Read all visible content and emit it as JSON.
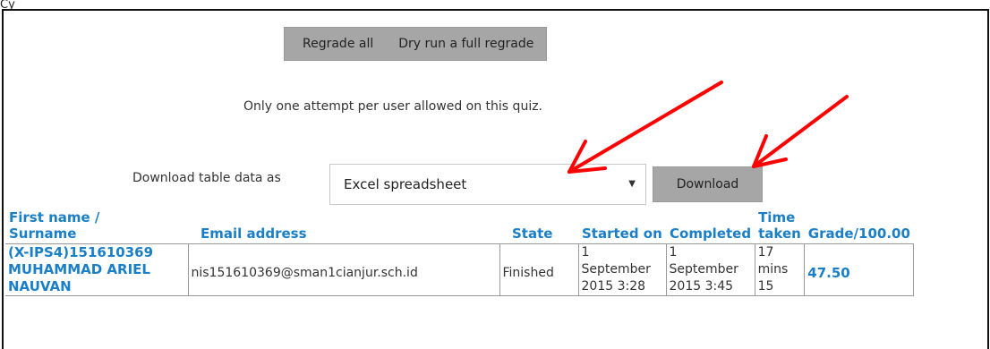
{
  "page": {
    "caption": "Cy",
    "regrade_all": "Regrade all",
    "dry_run": "Dry run a full regrade",
    "notice": "Only one attempt per user allowed on this quiz.",
    "download_label": "Download table data as",
    "download_format": "Excel spreadsheet",
    "download_button": "Download"
  },
  "table": {
    "headers": {
      "name_line1": "First name /",
      "name_line2": "Surname",
      "email": "Email address",
      "state": "State",
      "started": "Started on",
      "completed": "Completed",
      "time_line1": "Time",
      "time_line2": "taken",
      "grade": "Grade/100.00"
    },
    "rows": [
      {
        "name_line1": "(X-IPS4)151610369",
        "name_line2": "MUHAMMAD ARIEL",
        "name_line3": "NAUVAN",
        "email": "nis151610369@sman1cianjur.sch.id",
        "state": "Finished",
        "started_line1": "1",
        "started_line2": "September",
        "started_line3": "2015 3:28",
        "completed_line1": "1",
        "completed_line2": "September",
        "completed_line3": "2015 3:45",
        "time_line1": "17",
        "time_line2": "mins",
        "time_line3": "15",
        "grade": "47.50"
      }
    ]
  },
  "colors": {
    "link_blue": "#1a7fc6",
    "button_gray": "#a6a6a6",
    "arrow_red": "#ff0000"
  }
}
